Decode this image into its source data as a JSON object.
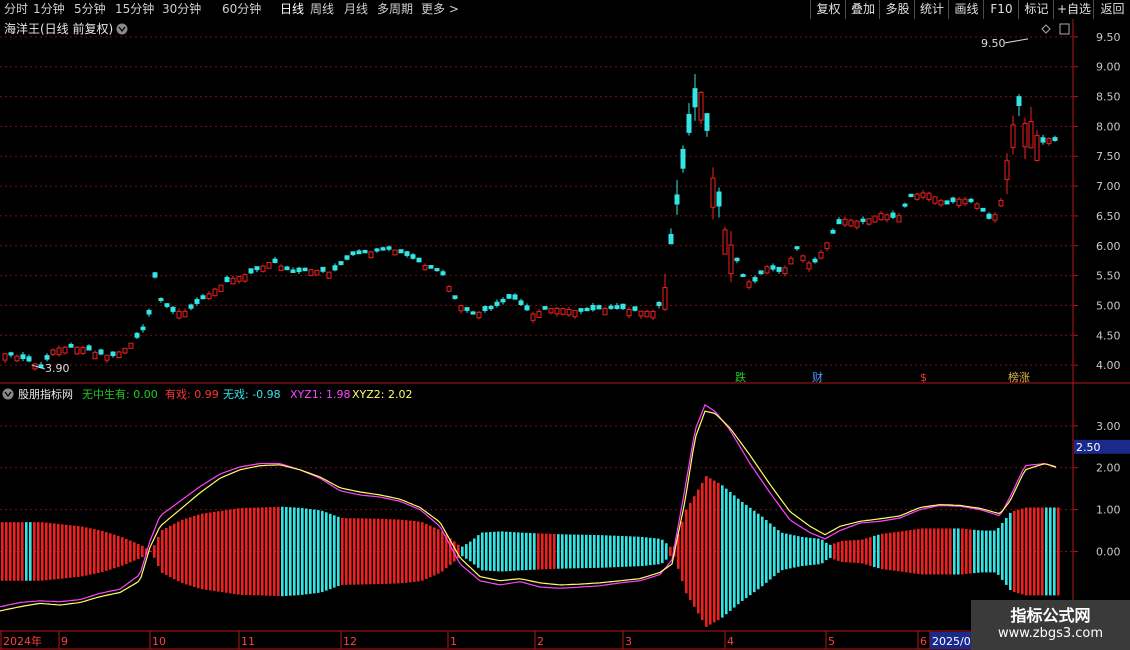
{
  "toolbar": {
    "periods": [
      "分时",
      "1分钟",
      "5分钟",
      "15分钟",
      "30分钟",
      "60分钟",
      "日线",
      "周线",
      "月线",
      "多周期"
    ],
    "more": "更多",
    "active_index": 6,
    "right_buttons": [
      "复权",
      "叠加",
      "多股",
      "统计",
      "画线",
      "F10",
      "标记",
      "+自选",
      "返回"
    ]
  },
  "price_panel": {
    "title": "海洋王(日线 前复权)",
    "max_label": "9.50",
    "min_label": "3.90",
    "y_ticks": [
      "9.50",
      "9.00",
      "8.50",
      "8.00",
      "7.50",
      "7.00",
      "6.50",
      "6.00",
      "5.50",
      "5.00",
      "4.50",
      "4.00"
    ],
    "markers": [
      {
        "text": "跌",
        "color": "#22cc22"
      },
      {
        "text": "财",
        "color": "#5599ff"
      },
      {
        "text": "$",
        "color": "#ff3333"
      },
      {
        "text": "榜涨",
        "color": "#d9b44a"
      }
    ]
  },
  "indicator_panel": {
    "name": "股朋指标网",
    "values": [
      {
        "label": "无中生有: 0.00",
        "color": "#22cc22"
      },
      {
        "label": "有戏: 0.99",
        "color": "#ff3333"
      },
      {
        "label": "无戏: -0.98",
        "color": "#33e6e6"
      },
      {
        "label": "XYZ1: 1.98",
        "color": "#ff44ff"
      },
      {
        "label": "XYZ2: 2.02",
        "color": "#ffff66"
      }
    ],
    "y_ticks": [
      "3.00",
      "2.00",
      "1.00",
      "0.00"
    ],
    "current_tag": "2.50"
  },
  "date_axis": {
    "labels": [
      "2024年",
      "9",
      "10",
      "11",
      "12",
      "1",
      "2",
      "3",
      "4",
      "5",
      "6",
      "2025/06"
    ]
  },
  "watermark": {
    "title": "指标公式网",
    "url": "www.zbgs3.com"
  },
  "chart_data": {
    "type": "candlestick_with_indicator",
    "price_ylim": [
      3.7,
      9.8
    ],
    "indicator_ylim": [
      -1.9,
      4.0
    ],
    "price_path": [
      [
        0,
        4.2
      ],
      [
        15,
        4.15
      ],
      [
        30,
        4.05
      ],
      [
        40,
        3.95
      ],
      [
        50,
        4.25
      ],
      [
        60,
        4.3
      ],
      [
        80,
        4.3
      ],
      [
        95,
        4.2
      ],
      [
        110,
        4.15
      ],
      [
        125,
        4.3
      ],
      [
        140,
        4.55
      ],
      [
        148,
        4.9
      ],
      [
        152,
        5.55
      ],
      [
        158,
        5.1
      ],
      [
        170,
        4.9
      ],
      [
        185,
        4.9
      ],
      [
        200,
        5.1
      ],
      [
        215,
        5.3
      ],
      [
        230,
        5.45
      ],
      [
        250,
        5.55
      ],
      [
        270,
        5.75
      ],
      [
        290,
        5.55
      ],
      [
        310,
        5.6
      ],
      [
        330,
        5.55
      ],
      [
        350,
        5.85
      ],
      [
        370,
        5.9
      ],
      [
        390,
        5.95
      ],
      [
        410,
        5.8
      ],
      [
        425,
        5.65
      ],
      [
        440,
        5.55
      ],
      [
        455,
        5.05
      ],
      [
        470,
        4.85
      ],
      [
        490,
        4.95
      ],
      [
        510,
        5.15
      ],
      [
        530,
        4.85
      ],
      [
        545,
        4.95
      ],
      [
        560,
        4.95
      ],
      [
        580,
        4.9
      ],
      [
        600,
        4.95
      ],
      [
        620,
        4.95
      ],
      [
        640,
        4.9
      ],
      [
        655,
        4.9
      ],
      [
        663,
        5.3
      ],
      [
        672,
        6.4
      ],
      [
        680,
        7.2
      ],
      [
        687,
        7.9
      ],
      [
        694,
        8.4
      ],
      [
        700,
        8.6
      ],
      [
        706,
        7.8
      ],
      [
        712,
        7.0
      ],
      [
        718,
        6.6
      ],
      [
        724,
        6.2
      ],
      [
        732,
        5.9
      ],
      [
        740,
        5.5
      ],
      [
        750,
        5.35
      ],
      [
        765,
        5.65
      ],
      [
        780,
        5.55
      ],
      [
        795,
        5.95
      ],
      [
        810,
        5.65
      ],
      [
        825,
        6.05
      ],
      [
        840,
        6.45
      ],
      [
        860,
        6.4
      ],
      [
        880,
        6.55
      ],
      [
        895,
        6.45
      ],
      [
        910,
        6.85
      ],
      [
        925,
        6.9
      ],
      [
        945,
        6.7
      ],
      [
        960,
        6.8
      ],
      [
        975,
        6.7
      ],
      [
        990,
        6.4
      ],
      [
        1000,
        6.8
      ],
      [
        1008,
        7.8
      ],
      [
        1016,
        8.4
      ],
      [
        1024,
        8.0
      ],
      [
        1030,
        8.1
      ],
      [
        1038,
        7.7
      ],
      [
        1046,
        7.8
      ],
      [
        1056,
        7.75
      ]
    ],
    "histogram": [
      [
        0,
        0.7
      ],
      [
        20,
        0.7
      ],
      [
        40,
        0.7
      ],
      [
        60,
        0.65
      ],
      [
        80,
        0.6
      ],
      [
        100,
        0.5
      ],
      [
        120,
        0.35
      ],
      [
        140,
        0.15
      ],
      [
        150,
        0.0
      ],
      [
        160,
        0.5
      ],
      [
        180,
        0.75
      ],
      [
        200,
        0.9
      ],
      [
        220,
        0.97
      ],
      [
        240,
        1.04
      ],
      [
        260,
        1.05
      ],
      [
        280,
        1.07
      ],
      [
        300,
        1.04
      ],
      [
        320,
        0.98
      ],
      [
        340,
        0.8
      ],
      [
        360,
        0.79
      ],
      [
        380,
        0.78
      ],
      [
        400,
        0.76
      ],
      [
        420,
        0.71
      ],
      [
        440,
        0.5
      ],
      [
        460,
        0.1
      ],
      [
        470,
        0.25
      ],
      [
        480,
        0.45
      ],
      [
        500,
        0.48
      ],
      [
        520,
        0.45
      ],
      [
        540,
        0.43
      ],
      [
        560,
        0.41
      ],
      [
        580,
        0.4
      ],
      [
        600,
        0.39
      ],
      [
        620,
        0.37
      ],
      [
        640,
        0.35
      ],
      [
        660,
        0.3
      ],
      [
        672,
        0.05
      ],
      [
        685,
        1.0
      ],
      [
        705,
        1.8
      ],
      [
        720,
        1.6
      ],
      [
        740,
        1.2
      ],
      [
        760,
        0.85
      ],
      [
        780,
        0.45
      ],
      [
        800,
        0.35
      ],
      [
        820,
        0.3
      ],
      [
        828,
        0.15
      ],
      [
        840,
        0.25
      ],
      [
        860,
        0.28
      ],
      [
        880,
        0.42
      ],
      [
        900,
        0.48
      ],
      [
        920,
        0.55
      ],
      [
        940,
        0.55
      ],
      [
        960,
        0.55
      ],
      [
        980,
        0.5
      ],
      [
        995,
        0.5
      ],
      [
        1010,
        0.95
      ],
      [
        1025,
        1.05
      ],
      [
        1056,
        1.05
      ]
    ],
    "histogram_cyan_ranges": [
      [
        25,
        32
      ],
      [
        280,
        340
      ],
      [
        460,
        535
      ],
      [
        555,
        665
      ],
      [
        720,
        830
      ],
      [
        870,
        880
      ],
      [
        950,
        960
      ],
      [
        970,
        1010
      ],
      [
        1045,
        1056
      ]
    ],
    "xyz1": [
      [
        0,
        -1.32
      ],
      [
        20,
        -1.22
      ],
      [
        40,
        -1.18
      ],
      [
        60,
        -1.2
      ],
      [
        80,
        -1.15
      ],
      [
        100,
        -1.0
      ],
      [
        120,
        -0.9
      ],
      [
        140,
        -0.55
      ],
      [
        150,
        0.25
      ],
      [
        160,
        0.85
      ],
      [
        180,
        1.2
      ],
      [
        200,
        1.55
      ],
      [
        220,
        1.85
      ],
      [
        240,
        2.02
      ],
      [
        260,
        2.1
      ],
      [
        280,
        2.1
      ],
      [
        300,
        1.95
      ],
      [
        320,
        1.75
      ],
      [
        340,
        1.45
      ],
      [
        360,
        1.35
      ],
      [
        380,
        1.3
      ],
      [
        400,
        1.2
      ],
      [
        420,
        1.0
      ],
      [
        440,
        0.6
      ],
      [
        460,
        -0.3
      ],
      [
        480,
        -0.7
      ],
      [
        500,
        -0.8
      ],
      [
        520,
        -0.72
      ],
      [
        540,
        -0.85
      ],
      [
        560,
        -0.88
      ],
      [
        580,
        -0.85
      ],
      [
        600,
        -0.82
      ],
      [
        620,
        -0.75
      ],
      [
        640,
        -0.7
      ],
      [
        660,
        -0.55
      ],
      [
        672,
        -0.2
      ],
      [
        685,
        1.5
      ],
      [
        695,
        2.9
      ],
      [
        705,
        3.5
      ],
      [
        715,
        3.35
      ],
      [
        730,
        2.9
      ],
      [
        750,
        2.1
      ],
      [
        770,
        1.4
      ],
      [
        790,
        0.75
      ],
      [
        810,
        0.45
      ],
      [
        825,
        0.3
      ],
      [
        840,
        0.5
      ],
      [
        860,
        0.68
      ],
      [
        880,
        0.72
      ],
      [
        900,
        0.8
      ],
      [
        920,
        1.0
      ],
      [
        940,
        1.1
      ],
      [
        960,
        1.08
      ],
      [
        980,
        1.0
      ],
      [
        1000,
        0.85
      ],
      [
        1010,
        1.3
      ],
      [
        1025,
        2.05
      ],
      [
        1045,
        2.1
      ],
      [
        1056,
        2.0
      ]
    ],
    "xyz2": [
      [
        0,
        -1.42
      ],
      [
        20,
        -1.32
      ],
      [
        40,
        -1.24
      ],
      [
        60,
        -1.28
      ],
      [
        80,
        -1.22
      ],
      [
        100,
        -1.08
      ],
      [
        120,
        -0.98
      ],
      [
        140,
        -0.7
      ],
      [
        150,
        0.1
      ],
      [
        160,
        0.6
      ],
      [
        180,
        1.0
      ],
      [
        200,
        1.4
      ],
      [
        220,
        1.75
      ],
      [
        240,
        1.95
      ],
      [
        260,
        2.05
      ],
      [
        280,
        2.07
      ],
      [
        300,
        1.95
      ],
      [
        320,
        1.78
      ],
      [
        340,
        1.52
      ],
      [
        360,
        1.42
      ],
      [
        380,
        1.35
      ],
      [
        400,
        1.25
      ],
      [
        420,
        1.05
      ],
      [
        440,
        0.7
      ],
      [
        460,
        -0.15
      ],
      [
        480,
        -0.6
      ],
      [
        500,
        -0.7
      ],
      [
        520,
        -0.65
      ],
      [
        540,
        -0.75
      ],
      [
        560,
        -0.8
      ],
      [
        580,
        -0.78
      ],
      [
        600,
        -0.75
      ],
      [
        620,
        -0.7
      ],
      [
        640,
        -0.65
      ],
      [
        660,
        -0.5
      ],
      [
        672,
        -0.3
      ],
      [
        685,
        1.2
      ],
      [
        695,
        2.7
      ],
      [
        705,
        3.35
      ],
      [
        715,
        3.3
      ],
      [
        730,
        2.95
      ],
      [
        750,
        2.3
      ],
      [
        770,
        1.6
      ],
      [
        790,
        0.95
      ],
      [
        810,
        0.6
      ],
      [
        825,
        0.4
      ],
      [
        840,
        0.6
      ],
      [
        860,
        0.72
      ],
      [
        880,
        0.78
      ],
      [
        900,
        0.85
      ],
      [
        920,
        1.05
      ],
      [
        940,
        1.12
      ],
      [
        960,
        1.1
      ],
      [
        980,
        1.03
      ],
      [
        1000,
        0.9
      ],
      [
        1010,
        1.2
      ],
      [
        1025,
        1.95
      ],
      [
        1045,
        2.1
      ],
      [
        1056,
        2.02
      ]
    ]
  }
}
